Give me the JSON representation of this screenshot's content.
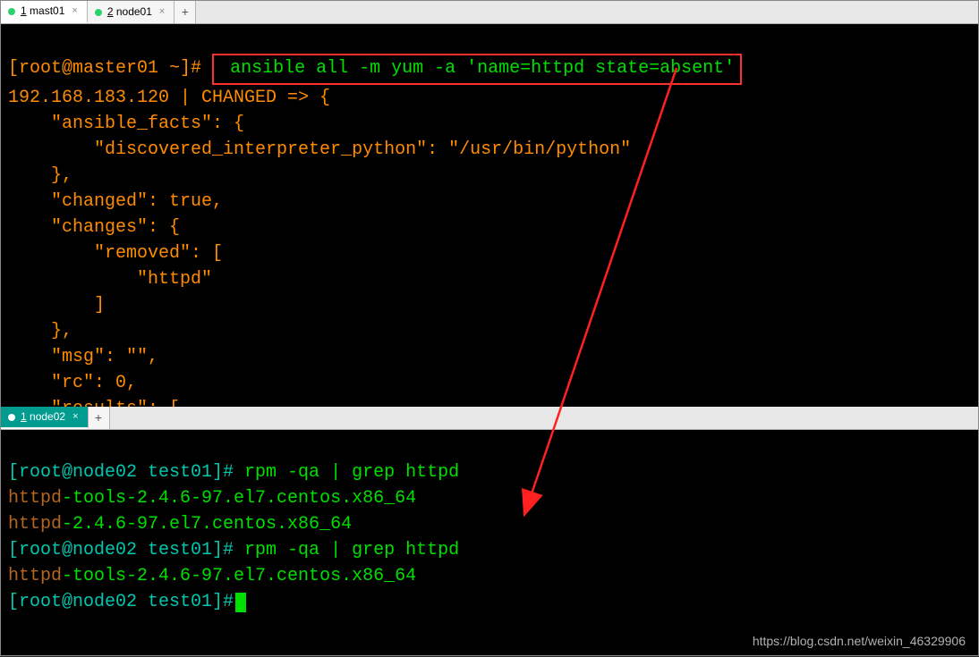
{
  "topTabs": {
    "tab1": {
      "dotColor": "#2bd46b",
      "num": "1",
      "label": "mast01"
    },
    "tab2": {
      "dotColor": "#2bd46b",
      "num": "2",
      "label": "node01"
    }
  },
  "bottomTabs": {
    "tab1": {
      "dotColor": "#ffffff",
      "num": "1",
      "label": "node02"
    }
  },
  "top": {
    "prompt": "[root@master01 ~]#",
    "command": " ansible all -m yum -a 'name=httpd state=absent'",
    "l1": "192.168.183.120 | CHANGED => {",
    "l2": "    \"ansible_facts\": {",
    "l3": "        \"discovered_interpreter_python\": \"/usr/bin/python\"",
    "l4": "    },",
    "l5": "    \"changed\": true,",
    "l6": "    \"changes\": {",
    "l7": "        \"removed\": [",
    "l8": "            \"httpd\"",
    "l9": "        ]",
    "l10": "    },",
    "l11": "    \"msg\": \"\",",
    "l12": "    \"rc\": 0,",
    "l13": "    \"results\": ["
  },
  "bottom": {
    "prompt": "[root@node02 test01]#",
    "cmd1": " rpm -qa | grep httpd",
    "r1a": "httpd",
    "r1b": "-tools-2.4.6-97.el7.centos.x86_64",
    "r2a": "httpd",
    "r2b": "-2.4.6-97.el7.centos.x86_64",
    "cmd2": " rpm -qa | grep httpd",
    "r3a": "httpd",
    "r3b": "-tools-2.4.6-97.el7.centos.x86_64"
  },
  "watermark": "https://blog.csdn.net/weixin_46329906"
}
